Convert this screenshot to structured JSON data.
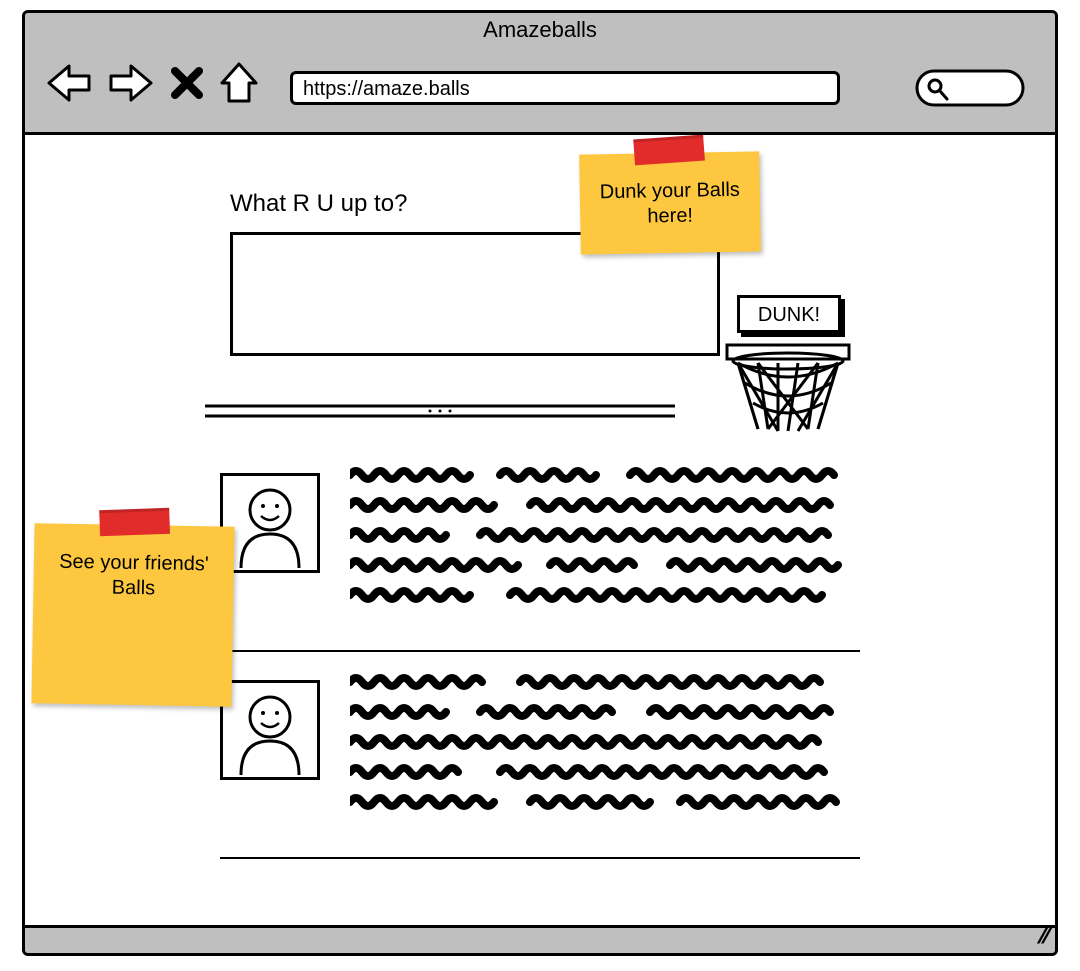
{
  "browser": {
    "title": "Amazeballs",
    "url": "https://amaze.balls"
  },
  "compose": {
    "prompt": "What R U up to?"
  },
  "dunk": {
    "button_label": "DUNK!"
  },
  "stickies": {
    "top": "Dunk your Balls here!",
    "left": "See your friends' Balls"
  }
}
